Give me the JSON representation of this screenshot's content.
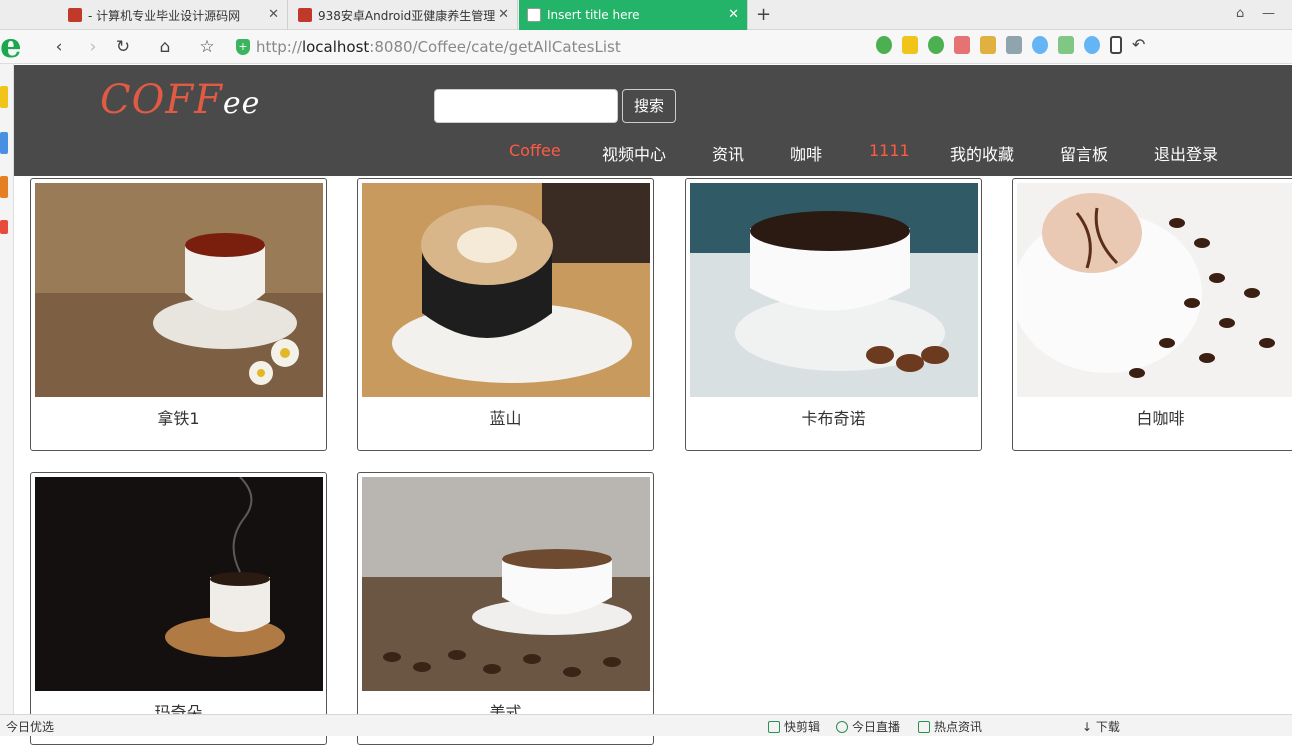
{
  "browser": {
    "tabs": [
      {
        "title": "- 计算机专业毕业设计源码网",
        "active": false
      },
      {
        "title": "938安卓Android亚健康养生管理",
        "active": false
      },
      {
        "title": "Insert title here",
        "active": true
      }
    ],
    "url_prefix": "http://",
    "url_host": "localhost",
    "url_rest": ":8080/Coffee/cate/getAllCatesList"
  },
  "site": {
    "logo_part1": "COFF",
    "logo_part2": "ee",
    "search_placeholder": "",
    "search_button": "搜索",
    "menu": [
      {
        "label": "Coffee",
        "active": true
      },
      {
        "label": "视频中心",
        "active": false
      },
      {
        "label": "资讯",
        "active": false
      },
      {
        "label": "咖啡",
        "active": false
      },
      {
        "label": "1111",
        "active": true
      },
      {
        "label": "我的收藏",
        "active": false
      },
      {
        "label": "留言板",
        "active": false
      },
      {
        "label": "退出登录",
        "active": false
      }
    ]
  },
  "cates": [
    {
      "name": "拿铁1",
      "bg": "#9a7b58"
    },
    {
      "name": "蓝山",
      "bg": "#b8874e"
    },
    {
      "name": "卡布奇诺",
      "bg": "#cdd6d8"
    },
    {
      "name": "白咖啡",
      "bg": "#ece8e4"
    },
    {
      "name": "玛奇朵",
      "bg": "#1a1410"
    },
    {
      "name": "美式",
      "bg": "#8d7b6a"
    }
  ],
  "statusbar": {
    "left": "今日优选",
    "items": [
      "快剪辑",
      "今日直播",
      "热点资讯",
      "下载"
    ]
  },
  "colors": {
    "header_bg": "#4a4a4a",
    "accent": "#ff5a44",
    "tab_active": "#23b46a"
  }
}
